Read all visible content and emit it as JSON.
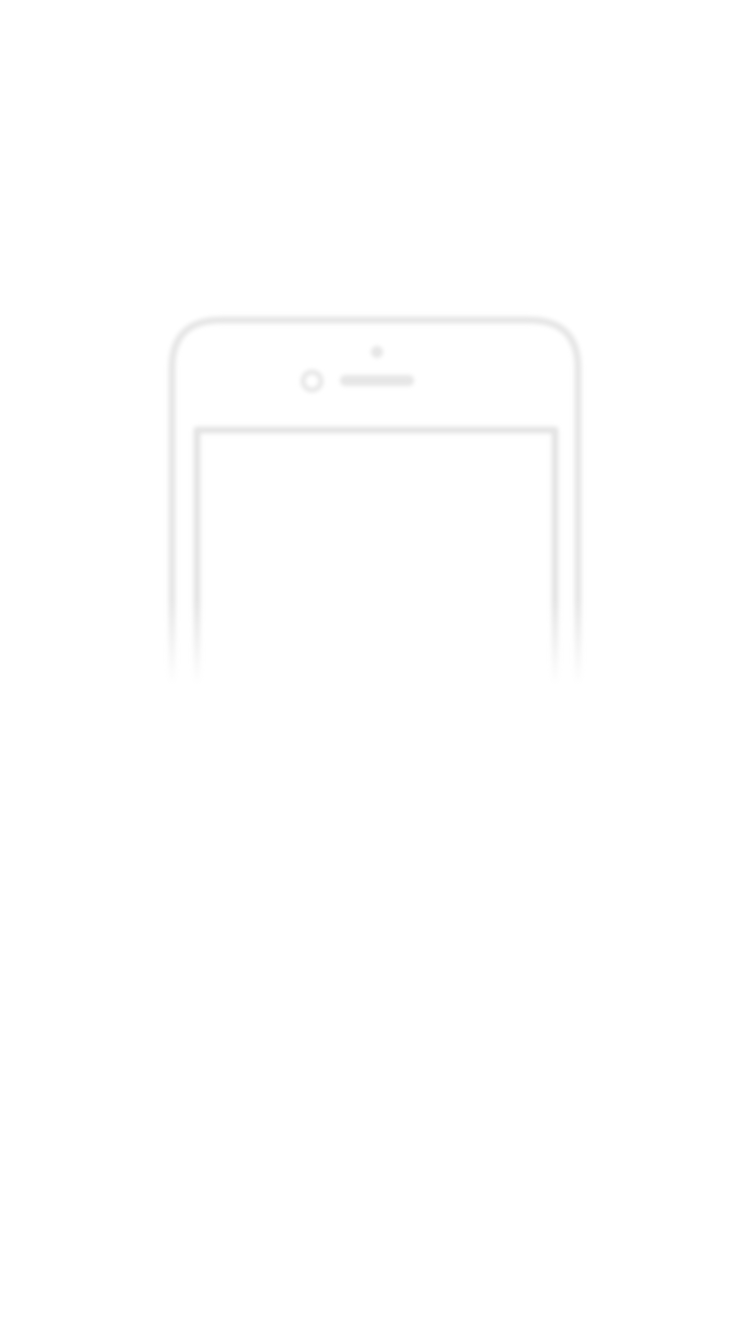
{
  "screen": {
    "background_color": "#ffffff",
    "illustration": {
      "icon": "phone-outline-icon",
      "line_color": "#e8e8e8",
      "style": "blurred outline, fading toward bottom"
    }
  }
}
